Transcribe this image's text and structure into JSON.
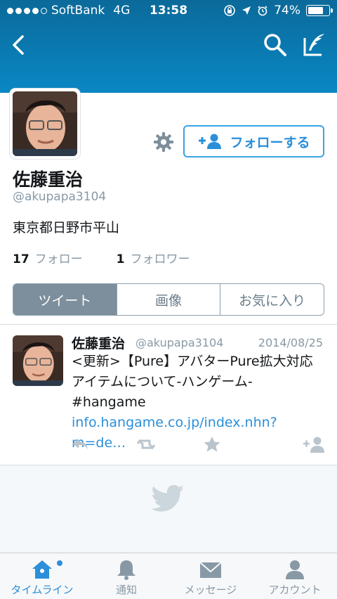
{
  "status_bar": {
    "carrier": "SoftBank",
    "network": "4G",
    "time": "13:58",
    "battery": "74%",
    "battery_level": 0.74,
    "signal_dots_filled": 4,
    "signal_dots_total": 5
  },
  "nav": {
    "back_icon": "chevron-left-icon",
    "search_icon": "search-icon",
    "compose_icon": "compose-icon"
  },
  "profile": {
    "name": "佐藤重治",
    "handle": "@akupapa3104",
    "location": "東京都日野市平山",
    "following_count": "17",
    "following_label": "フォロー",
    "followers_count": "1",
    "followers_label": "フォロワー",
    "follow_button": "フォローする"
  },
  "tabs": [
    "ツイート",
    "画像",
    "お気に入り"
  ],
  "tweet": {
    "name": "佐藤重治",
    "handle": "@akupapa3104",
    "date": "2014/08/25",
    "text": "<更新>【Pure】アバターPure拡大対応アイテムについて-ハンゲーム- #hangame ",
    "link": "info.hangame.co.jp/index.nhn?m=de…"
  },
  "tabbar": {
    "items": [
      {
        "label": "タイムライン",
        "icon": "home-icon"
      },
      {
        "label": "通知",
        "icon": "bell-icon"
      },
      {
        "label": "メッセージ",
        "icon": "envelope-icon"
      },
      {
        "label": "アカウント",
        "icon": "person-icon"
      }
    ]
  },
  "colors": {
    "header_top": "#0b6a9a",
    "header_bottom": "#0a87c4",
    "accent": "#2b8fd9",
    "muted": "#8899a6"
  }
}
